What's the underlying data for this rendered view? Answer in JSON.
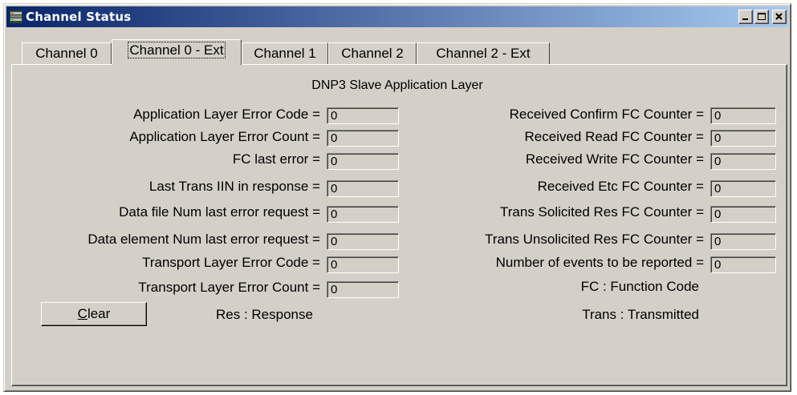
{
  "window": {
    "title": "Channel Status"
  },
  "tabs": [
    {
      "label": "Channel 0"
    },
    {
      "label": "Channel 0 - Ext"
    },
    {
      "label": "Channel 1"
    },
    {
      "label": "Channel 2"
    },
    {
      "label": "Channel 2 - Ext"
    }
  ],
  "active_tab": "Channel 0 - Ext",
  "heading": "DNP3 Slave Application Layer",
  "left_fields": [
    {
      "label": "Application Layer Error Code =",
      "value": "0"
    },
    {
      "label": "Application Layer Error Count =",
      "value": "0"
    },
    {
      "label": "FC last error =",
      "value": "0"
    },
    {
      "label": "Last Trans IIN in response =",
      "value": "0"
    },
    {
      "label": "Data file Num last error request =",
      "value": "0"
    },
    {
      "label": "Data element Num last error request =",
      "value": "0"
    },
    {
      "label": "Transport Layer Error Code =",
      "value": "0"
    },
    {
      "label": "Transport Layer Error Count =",
      "value": "0"
    }
  ],
  "right_fields": [
    {
      "label": "Received Confirm FC Counter =",
      "value": "0"
    },
    {
      "label": "Received Read FC Counter =",
      "value": "0"
    },
    {
      "label": "Received Write FC Counter =",
      "value": "0"
    },
    {
      "label": "Received Etc FC Counter =",
      "value": "0"
    },
    {
      "label": "Trans Solicited Res FC Counter =",
      "value": "0"
    },
    {
      "label": "Trans Unsolicited Res FC Counter =",
      "value": "0"
    },
    {
      "label": "Number of events to be reported =",
      "value": "0"
    }
  ],
  "notes": {
    "fc": "FC : Function Code",
    "res": "Res : Response",
    "trans": "Trans : Transmitted"
  },
  "clear_button": {
    "mnemonic": "C",
    "rest": "lear"
  },
  "colors": {
    "face": "#d4d0c8",
    "title_start": "#0a246a",
    "title_end": "#a6caf0"
  }
}
